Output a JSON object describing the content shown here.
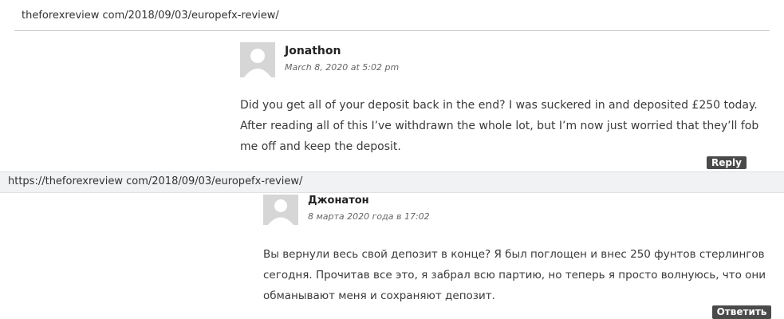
{
  "top_url": "theforexreview com/2018/09/03/europefx-review/",
  "comment_en": {
    "author": "Jonathon",
    "date": "March 8, 2020 at 5:02 pm",
    "body": "Did you get all of your deposit back in the end? I was suckered in and deposited £250 today. After reading all of this I’ve withdrawn the whole lot, but I’m now just worried that they’ll fob me off and keep the deposit.",
    "reply_label": "Reply"
  },
  "second_url": "https://theforexreview com/2018/09/03/europefx-review/",
  "comment_ru": {
    "author": "Джонатон",
    "date": "8 марта 2020 года в 17:02",
    "body": "Вы вернули весь свой депозит в конце? Я был поглощен и внес 250 фунтов стерлингов сегодня. Прочитав все это, я забрал всю партию, но теперь я просто волнуюсь, что они обманывают меня и сохраняют депозит.",
    "reply_label": "Ответить"
  },
  "icons": {
    "avatar": "default-user-avatar-icon"
  },
  "colors": {
    "reply_button": "#4a4a4a",
    "avatar_bg": "#d6d6d6",
    "url_bar_bg": "#f1f2f3"
  }
}
